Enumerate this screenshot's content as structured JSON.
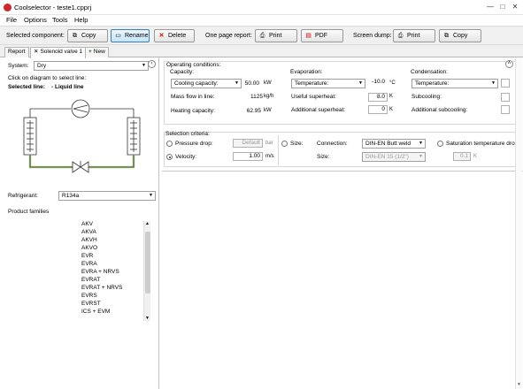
{
  "window": {
    "title": "Coolselector - teste1.cpprj",
    "controls": {
      "minimize": "—",
      "maximize": "□",
      "close": "✕"
    }
  },
  "menu": [
    "File",
    "Options",
    "Tools",
    "Help"
  ],
  "toolbar": {
    "selected_component_label": "Selected component:",
    "copy": "Copy",
    "rename": "Rename",
    "delete": "Delete",
    "one_page_report_label": "One page report:",
    "print": "Print",
    "pdf": "PDF",
    "screen_dump_label": "Screen dump:",
    "dump_print": "Print",
    "dump_copy": "Copy"
  },
  "tabs": {
    "report": "Report",
    "active": "Solenoid valve 1",
    "new": "New"
  },
  "left": {
    "system_label": "System:",
    "system_value": "Dry",
    "hint": "Click on diagram to select line:",
    "selected_line_label": "Selected line:",
    "selected_line_value": "- Liquid line",
    "refrigerant_label": "Refrigerant:",
    "refrigerant_value": "R134a",
    "product_families_label": "Product families",
    "product_families": [
      "AKV",
      "AKVA",
      "AKVH",
      "AKVO",
      "EVR",
      "EVRA",
      "EVRA + NRVS",
      "EVRAT",
      "EVRAT + NRVS",
      "EVRS",
      "EVRST",
      "ICS + EVM"
    ]
  },
  "operating": {
    "title": "Operating conditions:",
    "capacity": {
      "title": "Capacity:",
      "select": "Cooling capacity:",
      "value": "50.00",
      "unit": "kW",
      "mass_flow_label": "Mass flow in line:",
      "mass_flow_value": "1125",
      "mass_flow_unit": "kg/h",
      "heating_label": "Heating capacity:",
      "heating_value": "62.95",
      "heating_unit": "kW"
    },
    "evaporation": {
      "title": "Evaporation:",
      "select": "Temperature:",
      "value": "-10.0",
      "unit": "°C",
      "useful_label": "Useful superheat:",
      "useful_value": "8.0",
      "useful_unit": "K",
      "additional_label": "Additional superheat:",
      "additional_value": "0",
      "additional_unit": "K"
    },
    "condensation": {
      "title": "Condensation:",
      "select": "Temperature:",
      "subcooling_label": "Subcooling:",
      "additional_label": "Additional subcooling:"
    }
  },
  "selection": {
    "title": "Selection criteria:",
    "pressure_drop_label": "Pressure drop:",
    "pressure_drop_value": "Default",
    "pressure_drop_unit": "bar",
    "velocity_label": "Velocity:",
    "velocity_value": "1.00",
    "velocity_unit": "m/s",
    "size_label": "Size:",
    "connection_label": "Connection:",
    "connection_value": "DIN-EN Butt weld",
    "size2_label": "Size:",
    "size2_value": "DIN-EN 15 (1/2\")",
    "saturation_label": "Saturation temperature drop",
    "saturation_value": "0.1",
    "saturation_unit": "K"
  }
}
